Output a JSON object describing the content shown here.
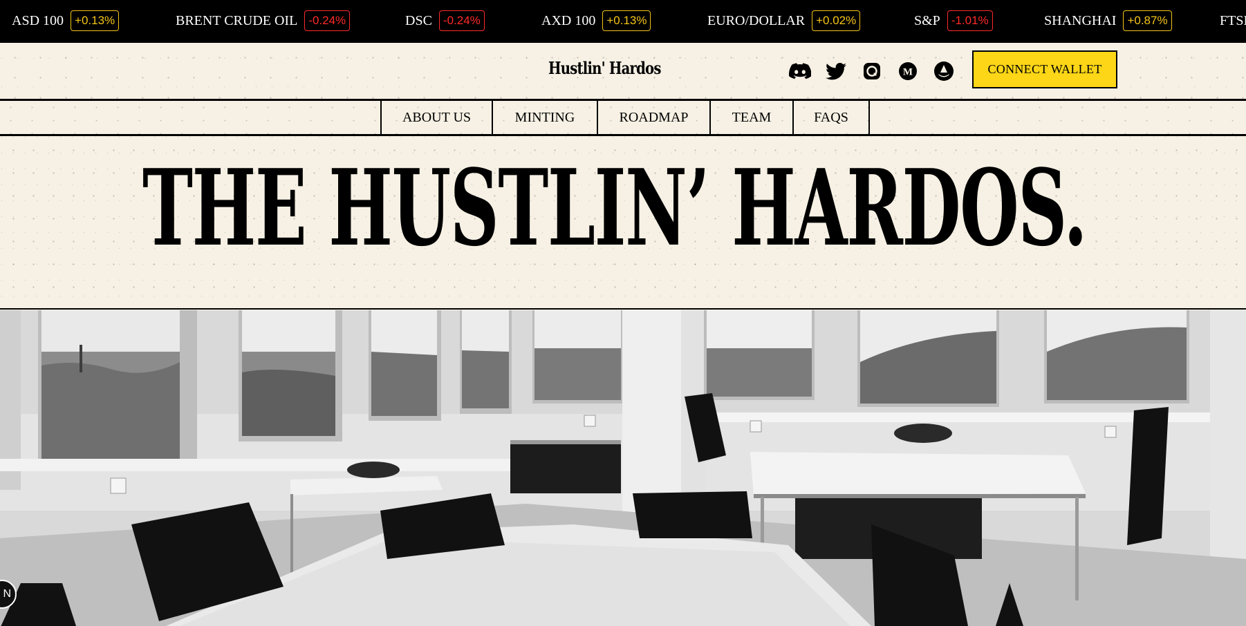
{
  "ticker": [
    {
      "name": "ASD 100",
      "change": "+0.13%",
      "direction": "up"
    },
    {
      "name": "BRENT CRUDE OIL",
      "change": "-0.24%",
      "direction": "down"
    },
    {
      "name": "DSC",
      "change": "-0.24%",
      "direction": "down"
    },
    {
      "name": "AXD 100",
      "change": "+0.13%",
      "direction": "up"
    },
    {
      "name": "EURO/DOLLAR",
      "change": "+0.02%",
      "direction": "up"
    },
    {
      "name": "S&P",
      "change": "-1.01%",
      "direction": "down"
    },
    {
      "name": "SHANGHAI",
      "change": "+0.87%",
      "direction": "up"
    },
    {
      "name": "FTSE",
      "change": "",
      "direction": "up"
    }
  ],
  "header": {
    "brand": "Hustlin' Hardos",
    "social": [
      "discord-icon",
      "twitter-icon",
      "opensea-icon",
      "medium-icon",
      "looksrare-icon"
    ],
    "connect_label": "CONNECT WALLET"
  },
  "nav": {
    "items": [
      "ABOUT US",
      "MINTING",
      "ROADMAP",
      "TEAM",
      "FAQS"
    ]
  },
  "hero": {
    "title": "THE HUSTLIN’ HARDOS."
  },
  "corner_badge": "N",
  "colors": {
    "accent": "#fcd617",
    "paper": "#f6f1e4",
    "ticker_bg": "#000000",
    "up": "#f5c518",
    "down": "#ff2a2a"
  }
}
